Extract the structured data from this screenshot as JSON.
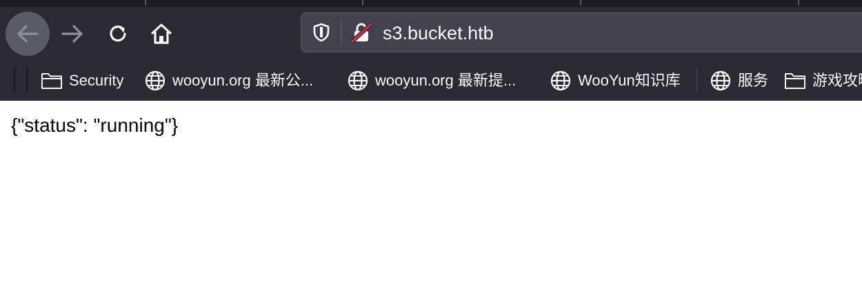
{
  "browser": {
    "url": "s3.bucket.htb",
    "icons": {
      "back": "back-arrow-icon",
      "forward": "forward-arrow-icon",
      "reload": "reload-icon",
      "home": "home-icon",
      "tracking": "shield-icon",
      "insecure": "insecure-lock-icon"
    }
  },
  "bookmarks": [
    {
      "label": "Security",
      "icon": "folder-icon"
    },
    {
      "label": "wooyun.org 最新公...",
      "icon": "globe-icon"
    },
    {
      "label": "wooyun.org 最新提...",
      "icon": "globe-icon"
    },
    {
      "label": "WooYun知识库",
      "icon": "globe-icon"
    },
    {
      "label": "服务",
      "icon": "globe-icon"
    },
    {
      "label": "游戏攻略",
      "icon": "folder-icon"
    }
  ],
  "page": {
    "body_text": "{\"status\": \"running\"}"
  },
  "colors": {
    "toolbar_bg": "#2b2a33",
    "urlbar_bg": "#42414d",
    "text_light": "#fbfbfe",
    "insecure_strike": "#e22850"
  }
}
